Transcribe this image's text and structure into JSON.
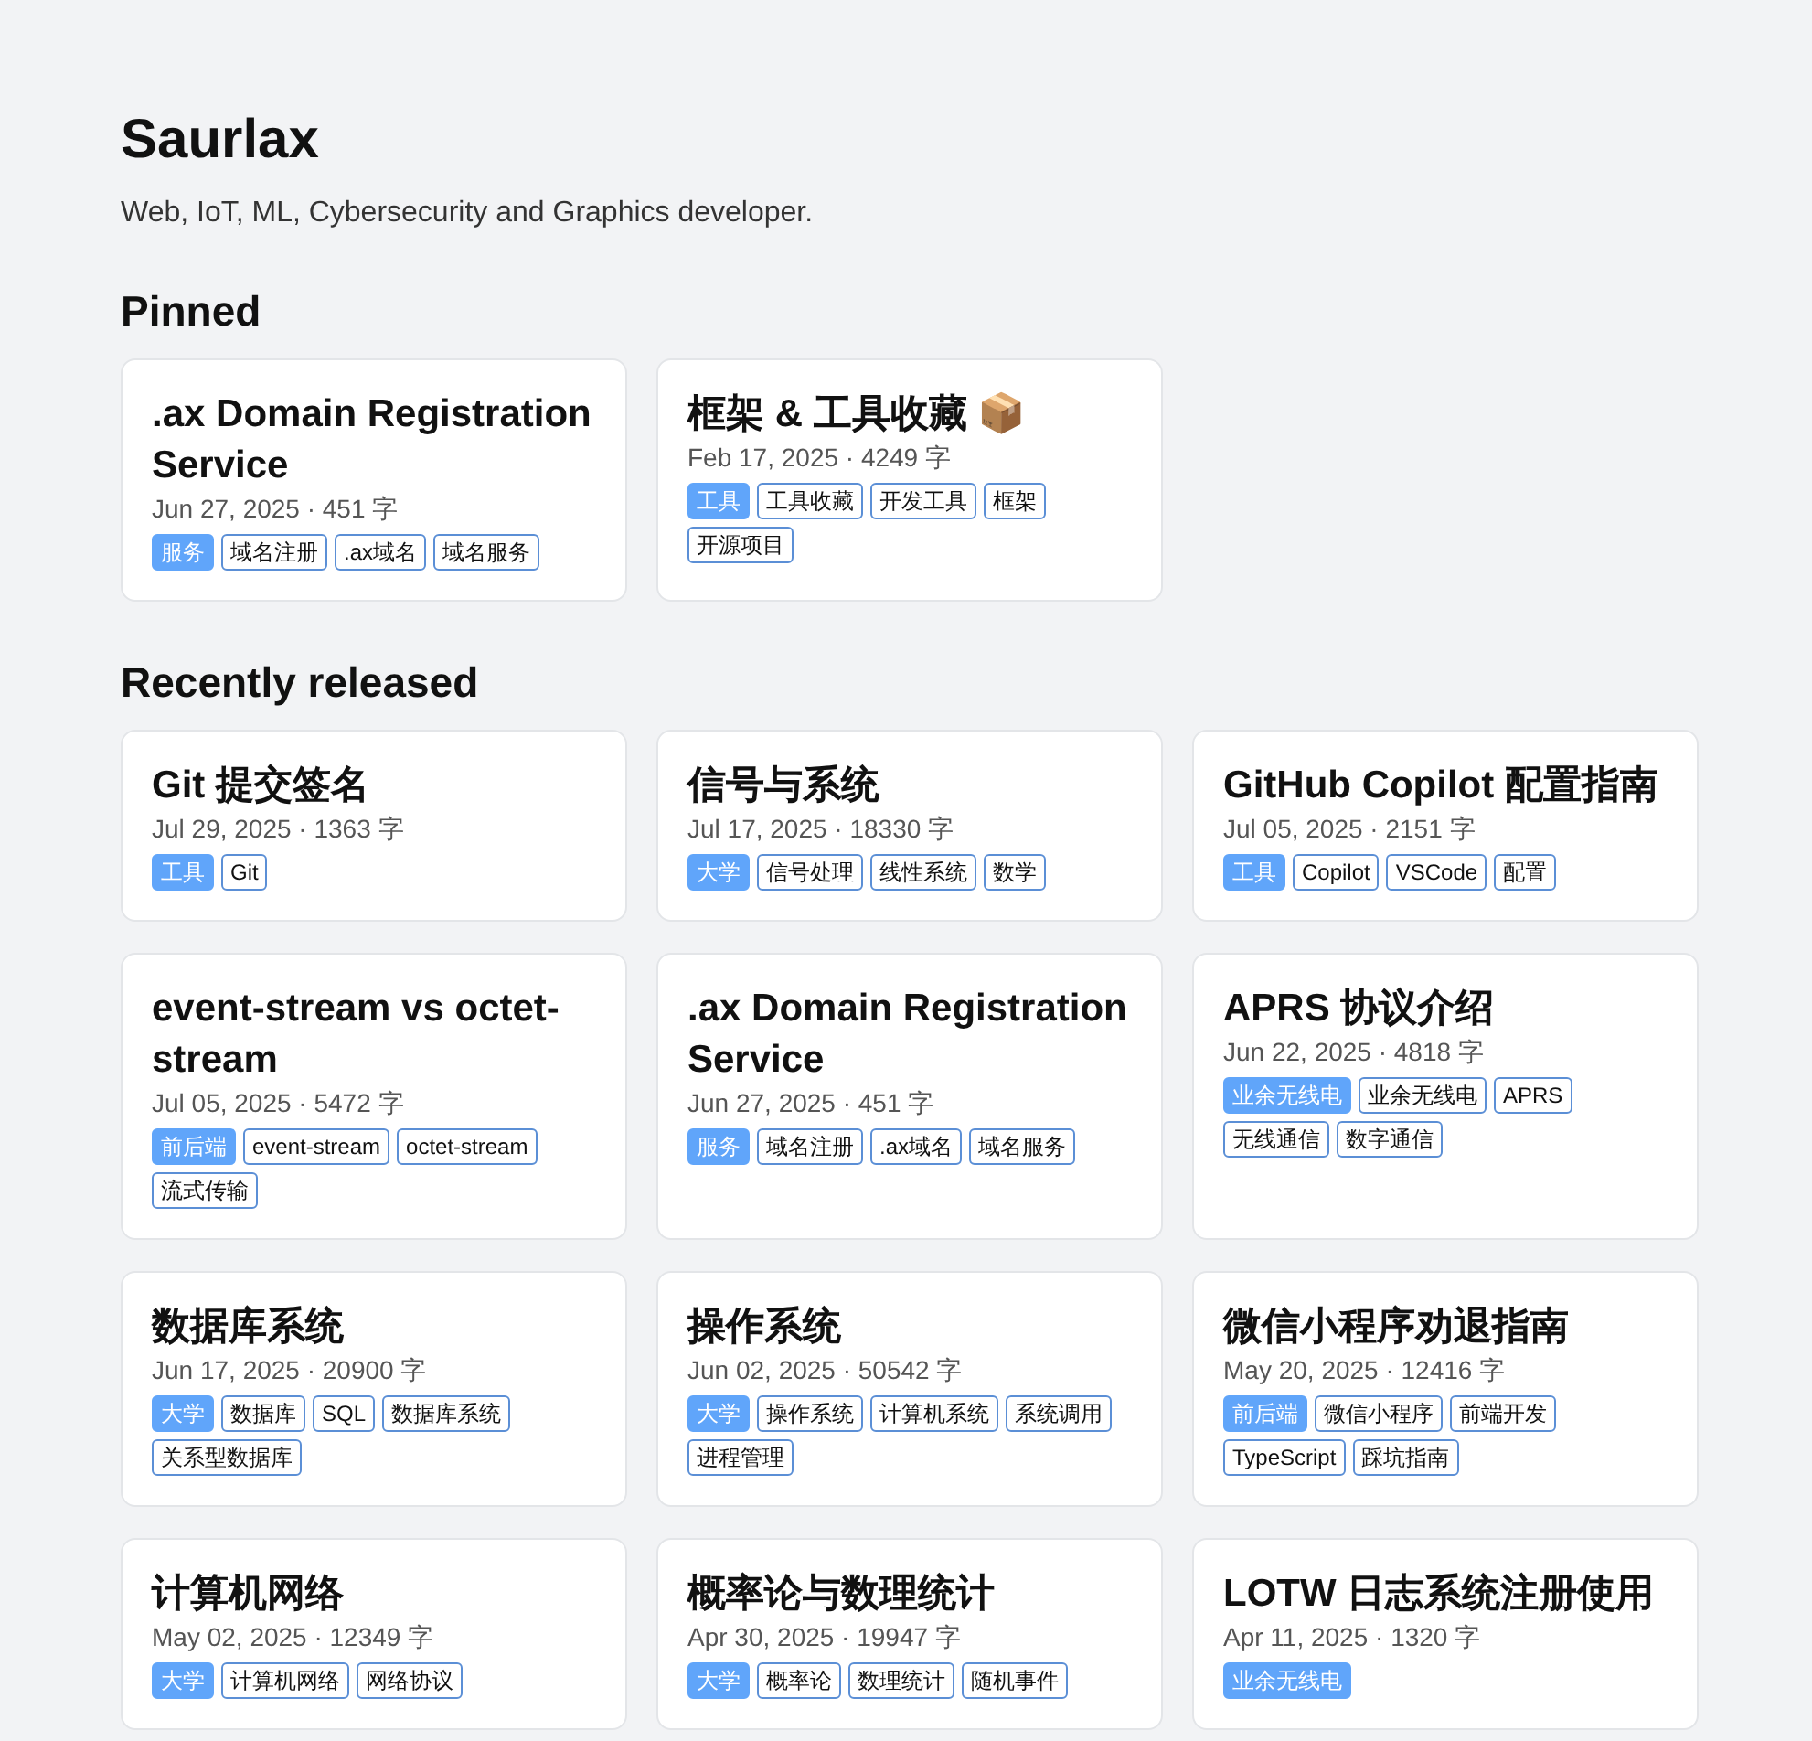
{
  "profile": {
    "name": "Saurlax",
    "bio": "Web, IoT, ML, Cybersecurity and Graphics developer."
  },
  "sections": [
    {
      "title": "Pinned",
      "posts": [
        {
          "title": ".ax Domain Registration Service",
          "meta": "Jun 27, 2025 · 451 字",
          "category": "服务",
          "tags": [
            "域名注册",
            ".ax域名",
            "域名服务"
          ]
        },
        {
          "title": "框架 & 工具收藏 📦",
          "meta": "Feb 17, 2025 · 4249 字",
          "category": "工具",
          "tags": [
            "工具收藏",
            "开发工具",
            "框架",
            "开源项目"
          ]
        }
      ]
    },
    {
      "title": "Recently released",
      "posts": [
        {
          "title": "Git 提交签名",
          "meta": "Jul 29, 2025 · 1363 字",
          "category": "工具",
          "tags": [
            "Git"
          ]
        },
        {
          "title": "信号与系统",
          "meta": "Jul 17, 2025 · 18330 字",
          "category": "大学",
          "tags": [
            "信号处理",
            "线性系统",
            "数学"
          ]
        },
        {
          "title": "GitHub Copilot 配置指南",
          "meta": "Jul 05, 2025 · 2151 字",
          "category": "工具",
          "tags": [
            "Copilot",
            "VSCode",
            "配置"
          ]
        },
        {
          "title": "event-stream vs octet-stream",
          "meta": "Jul 05, 2025 · 5472 字",
          "category": "前后端",
          "tags": [
            "event-stream",
            "octet-stream",
            "流式传输"
          ]
        },
        {
          "title": ".ax Domain Registration Service",
          "meta": "Jun 27, 2025 · 451 字",
          "category": "服务",
          "tags": [
            "域名注册",
            ".ax域名",
            "域名服务"
          ]
        },
        {
          "title": "APRS 协议介绍",
          "meta": "Jun 22, 2025 · 4818 字",
          "category": "业余无线电",
          "tags": [
            "业余无线电",
            "APRS",
            "无线通信",
            "数字通信"
          ]
        },
        {
          "title": "数据库系统",
          "meta": "Jun 17, 2025 · 20900 字",
          "category": "大学",
          "tags": [
            "数据库",
            "SQL",
            "数据库系统",
            "关系型数据库"
          ]
        },
        {
          "title": "操作系统",
          "meta": "Jun 02, 2025 · 50542 字",
          "category": "大学",
          "tags": [
            "操作系统",
            "计算机系统",
            "系统调用",
            "进程管理"
          ]
        },
        {
          "title": "微信小程序劝退指南",
          "meta": "May 20, 2025 · 12416 字",
          "category": "前后端",
          "tags": [
            "微信小程序",
            "前端开发",
            "TypeScript",
            "踩坑指南"
          ]
        },
        {
          "title": "计算机网络",
          "meta": "May 02, 2025 · 12349 字",
          "category": "大学",
          "tags": [
            "计算机网络",
            "网络协议"
          ]
        },
        {
          "title": "概率论与数理统计",
          "meta": "Apr 30, 2025 · 19947 字",
          "category": "大学",
          "tags": [
            "概率论",
            "数理统计",
            "随机事件"
          ]
        },
        {
          "title": "LOTW 日志系统注册使用",
          "meta": "Apr 11, 2025 · 1320 字",
          "category": "业余无线电"
        }
      ]
    }
  ]
}
